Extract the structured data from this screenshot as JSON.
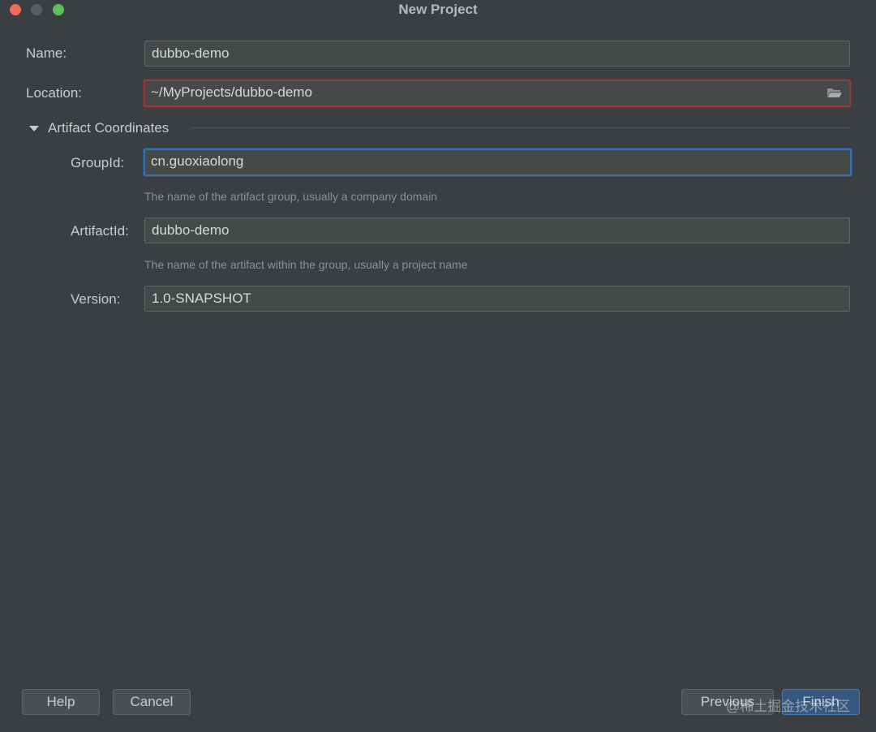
{
  "window": {
    "title": "New Project"
  },
  "form": {
    "name": {
      "label": "Name:",
      "value": "dubbo-demo"
    },
    "location": {
      "label": "Location:",
      "value": "~/MyProjects/dubbo-demo"
    },
    "section": {
      "title": "Artifact Coordinates"
    },
    "group_id": {
      "label": "GroupId:",
      "value": "cn.guoxiaolong",
      "hint": "The name of the artifact group, usually a company domain"
    },
    "artifact_id": {
      "label": "ArtifactId:",
      "value": "dubbo-demo",
      "hint": "The name of the artifact within the group, usually a project name"
    },
    "version": {
      "label": "Version:",
      "value": "1.0-SNAPSHOT"
    }
  },
  "buttons": {
    "help": "Help",
    "cancel": "Cancel",
    "previous": "Previous",
    "finish": "Finish"
  },
  "watermark": "@稀土掘金技术社区",
  "colors": {
    "background": "#3c3f41",
    "field_bg": "#45494a",
    "error_border": "#8b3c3c",
    "focus_border": "#3d6fa5",
    "primary_button": "#365880"
  }
}
